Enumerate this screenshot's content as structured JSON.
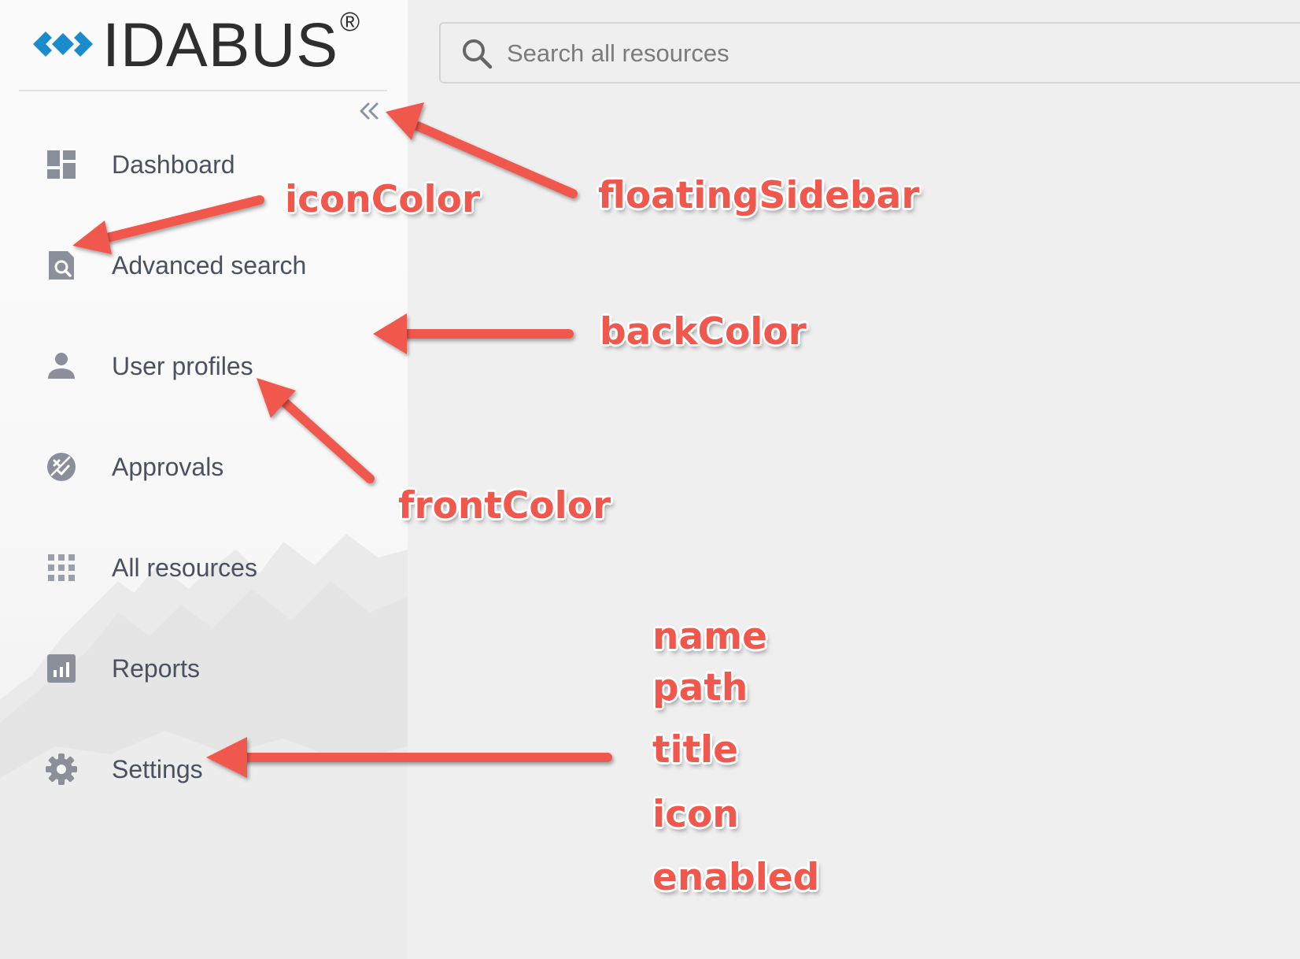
{
  "brand": {
    "name": "IDABUS",
    "reg_mark": "®",
    "accent": "#1a8ccc"
  },
  "sidebar": {
    "collapse_icon": "double-chevron-left-icon",
    "items": [
      {
        "label": "Dashboard",
        "icon": "dashboard-icon"
      },
      {
        "label": "Advanced search",
        "icon": "document-search-icon"
      },
      {
        "label": "User profiles",
        "icon": "person-icon"
      },
      {
        "label": "Approvals",
        "icon": "approval-badge-icon"
      },
      {
        "label": "All resources",
        "icon": "grid-dots-icon"
      },
      {
        "label": "Reports",
        "icon": "bar-chart-icon"
      },
      {
        "label": "Settings",
        "icon": "gear-icon"
      }
    ]
  },
  "search": {
    "placeholder": "Search all resources",
    "value": "",
    "icon": "search-icon"
  },
  "annotations": {
    "color": "#f0584d",
    "labels": {
      "icon_color": "iconColor",
      "floating_sidebar": "floatingSidebar",
      "back_color": "backColor",
      "front_color": "frontColor",
      "name": "name",
      "path": "path",
      "title": "title",
      "icon": "icon",
      "enabled": "enabled"
    }
  }
}
